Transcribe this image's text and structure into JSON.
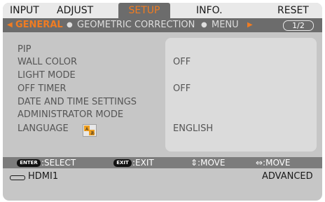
{
  "tabs": [
    {
      "label": "INPUT"
    },
    {
      "label": "ADJUST"
    },
    {
      "label": "SETUP",
      "active": true
    },
    {
      "label": "INFO."
    },
    {
      "label": "RESET"
    }
  ],
  "subtabs": [
    {
      "label": "GENERAL",
      "active": true
    },
    {
      "label": "GEOMETRIC CORRECTION"
    },
    {
      "label": "MENU"
    }
  ],
  "page_indicator": "1/2",
  "items": [
    {
      "label": "PIP",
      "value": ""
    },
    {
      "label": "WALL COLOR",
      "value": "OFF"
    },
    {
      "label": "LIGHT MODE",
      "value": ""
    },
    {
      "label": "OFF TIMER",
      "value": "OFF"
    },
    {
      "label": "DATE AND TIME SETTINGS",
      "value": ""
    },
    {
      "label": "ADMINISTRATOR MODE",
      "value": ""
    },
    {
      "label": "LANGUAGE",
      "value": "ENGLISH"
    }
  ],
  "help": {
    "enter_key": "ENTER",
    "select": ":SELECT",
    "exit_key": "EXIT",
    "exit": ":EXIT",
    "move_updown": "⇕:MOVE",
    "move_leftright": "⇔:MOVE"
  },
  "status": {
    "input_source": "HDMI1",
    "mode": "ADVANCED"
  },
  "colors": {
    "accent": "#f07c22",
    "menu_bg": "#c6c6c6",
    "active_tab_bg": "#6c6c6c"
  }
}
